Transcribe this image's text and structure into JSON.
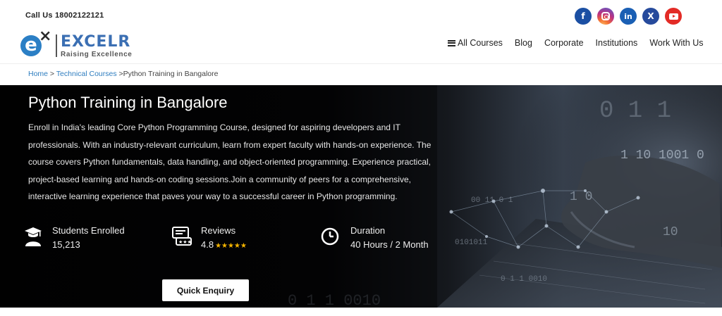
{
  "header": {
    "call_text": "Call Us 18002122121",
    "logo": {
      "brand": "EXCELR",
      "tagline": "Raising Excellence"
    },
    "socials": [
      {
        "name": "facebook-icon",
        "glyph": "f"
      },
      {
        "name": "instagram-icon",
        "glyph": ""
      },
      {
        "name": "linkedin-icon",
        "glyph": "in"
      },
      {
        "name": "x-twitter-icon",
        "glyph": "X"
      },
      {
        "name": "youtube-icon",
        "glyph": ""
      }
    ],
    "nav": {
      "all_courses": "All Courses",
      "blog": "Blog",
      "corporate": "Corporate",
      "institutions": "Institutions",
      "work_with_us": "Work With Us"
    }
  },
  "breadcrumb": {
    "home": "Home",
    "sep1": " > ",
    "technical": "Technical Courses",
    "current": " >Python Training in Bangalore"
  },
  "hero": {
    "title": "Python Training in Bangalore",
    "description": "Enroll in India's leading Core Python Programming Course, designed for aspiring developers and IT professionals. With an industry-relevant curriculum, learn from expert faculty with hands-on experience. The course covers Python fundamentals, data handling, and object-oriented programming. Experience practical, project-based learning and hands-on coding sessions.Join a community of peers for a comprehensive, interactive learning experience that paves your way to a successful career in Python programming.",
    "stats": {
      "students": {
        "label": "Students Enrolled",
        "value": "15,213",
        "icon": "graduate-icon"
      },
      "reviews": {
        "label": "Reviews",
        "value": "4.8",
        "stars": "★★★★★",
        "icon": "review-icon"
      },
      "duration": {
        "label": "Duration",
        "value": "40 Hours / 2 Month",
        "icon": "clock-icon"
      }
    },
    "cta": "Quick Enquiry",
    "background_digits": [
      "0 1 1",
      "1 10  1001  0",
      "1  0",
      "00 11 0 1",
      "0 1 1 0010",
      "0101011",
      "10",
      "0 1 1 0010"
    ]
  },
  "colors": {
    "accent_blue": "#2e7dbf",
    "brand_blue": "#3b6fb3",
    "hero_dark": "#030303",
    "star": "#f5b400"
  }
}
